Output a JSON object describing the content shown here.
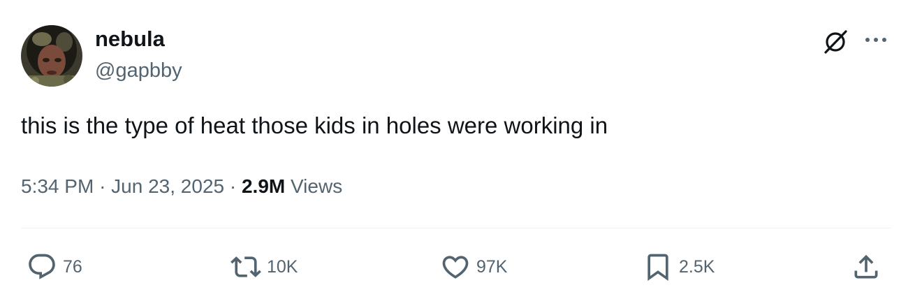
{
  "author": {
    "display_name": "nebula",
    "handle": "@gapbby",
    "avatar_icon": "profile-photo"
  },
  "tweet": {
    "text": "this is the type of heat those kids in holes were working in",
    "time": "5:34 PM",
    "date": "Jun 23, 2025",
    "views_count": "2.9M",
    "views_label": "Views"
  },
  "actions": {
    "replies": "76",
    "reposts": "10K",
    "likes": "97K",
    "bookmarks": "2.5K"
  },
  "icons": {
    "grok": "grok-icon",
    "more": "more-options-icon",
    "reply": "reply-icon",
    "repost": "repost-icon",
    "like": "heart-icon",
    "bookmark": "bookmark-icon",
    "share": "share-icon"
  },
  "colors": {
    "text_primary": "#0f1419",
    "text_secondary": "#536471",
    "divider": "#eff3f4"
  }
}
